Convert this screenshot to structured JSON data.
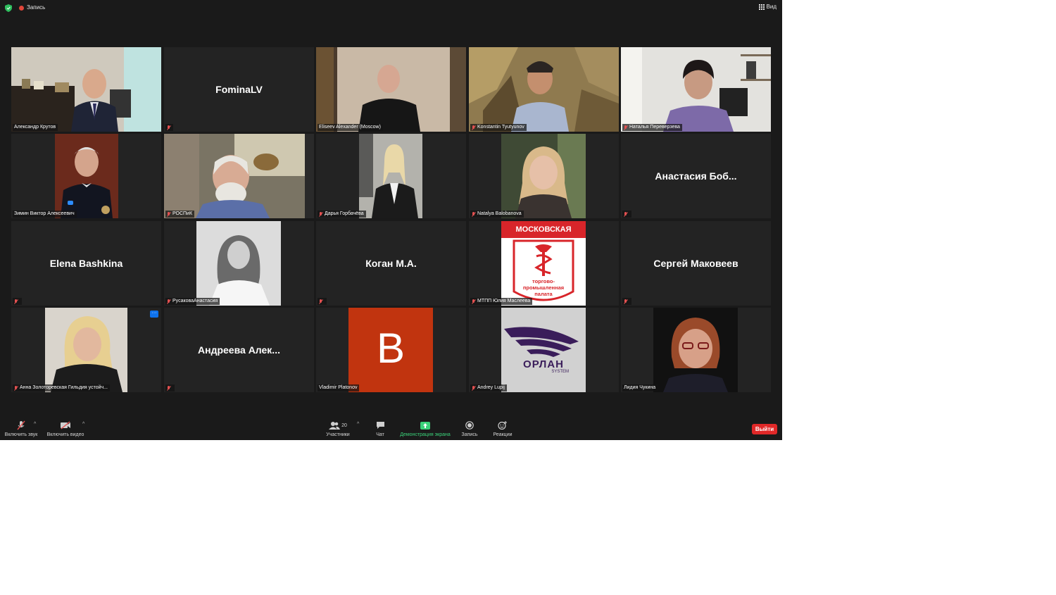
{
  "topbar": {
    "recording_label": "Запись",
    "view_label": "Вид"
  },
  "tiles": [
    {
      "name": "Александр Крутов",
      "display": "video",
      "muted": false,
      "active": true
    },
    {
      "name": "FominaLV",
      "display": "name",
      "muted": true
    },
    {
      "name": "Eliseev Alexander (Moscow)",
      "display": "video",
      "muted": false
    },
    {
      "name": "Konstantin Tyutyunov",
      "display": "video",
      "muted": true
    },
    {
      "name": "Наталья Переверзева",
      "display": "video",
      "muted": true
    },
    {
      "name": "Зимин Виктор Алексеевич",
      "display": "photo",
      "muted": false
    },
    {
      "name": "РОСПиК",
      "display": "video",
      "muted": true
    },
    {
      "name": "Дарья Горбачёва",
      "display": "photo",
      "muted": true
    },
    {
      "name": "Natalya Balobanova",
      "display": "photo",
      "muted": true
    },
    {
      "name": "Анастасия  Боб...",
      "label": "",
      "display": "name",
      "muted": true
    },
    {
      "name": "Elena Bashkina",
      "label": "",
      "display": "name",
      "muted": true
    },
    {
      "name": "РусаковаАнастасия",
      "display": "photo",
      "muted": true
    },
    {
      "name": "Коган М.А.",
      "label": "",
      "display": "name",
      "muted": true
    },
    {
      "name": "МТПП Юлия Маслеева",
      "display": "logo-mtpp",
      "muted": true
    },
    {
      "name": "Сергей Маковеев",
      "label": "",
      "display": "name",
      "muted": true
    },
    {
      "name": "Анна Золоторевская Гильдия устойч...",
      "display": "photo",
      "muted": true
    },
    {
      "name": "Андреева  Алек...",
      "label": "",
      "display": "name",
      "muted": true
    },
    {
      "name": "Vladimir Platonov",
      "display": "avatar",
      "avatar_letter": "B",
      "muted": false
    },
    {
      "name": "Andrey Lupij",
      "display": "logo-orlan",
      "muted": true
    },
    {
      "name": "Лидия Чукина",
      "display": "photo",
      "muted": false
    }
  ],
  "logos": {
    "mtpp_top": "МОСКОВСКАЯ",
    "mtpp_bottom": "торгово-\nпромышленная\nпалата",
    "orlan_main": "ОРЛАН",
    "orlan_sub": "SYSTEM"
  },
  "toolbar": {
    "unmute": "Включить звук",
    "start_video": "Включить видео",
    "participants": "Участники",
    "participants_count": "20",
    "chat": "Чат",
    "share": "Демонстрация экрана",
    "record": "Запись",
    "reactions": "Реакции",
    "leave": "Выйти"
  },
  "colors": {
    "active_speaker": "#c6e83c",
    "leave_button": "#e02828",
    "share_green": "#3bd27a",
    "muted_red": "#e35151"
  }
}
